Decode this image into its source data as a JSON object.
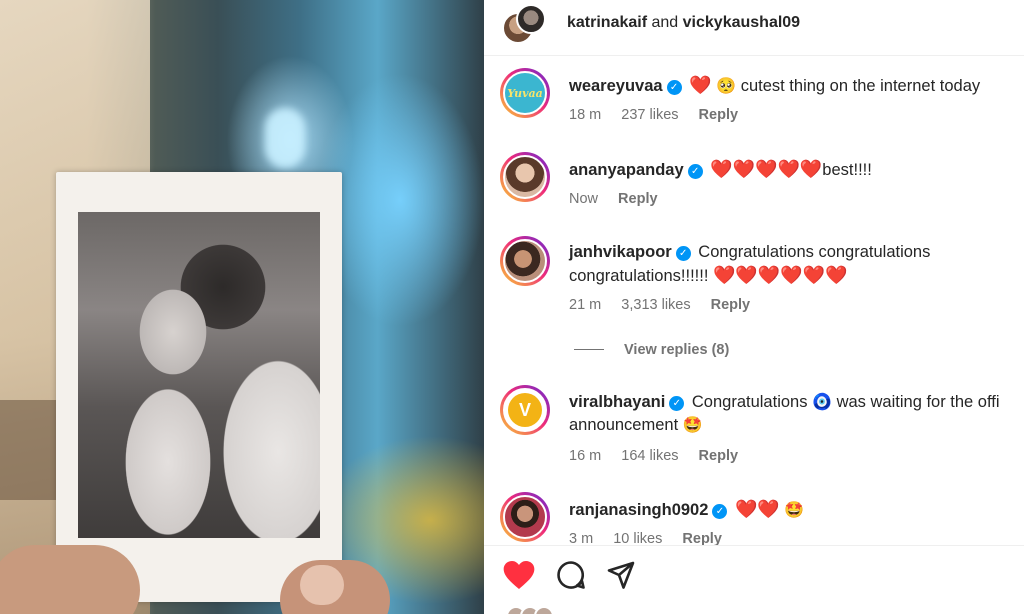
{
  "header": {
    "user1": "katrinakaif",
    "conjunction": "and",
    "user2": "vickykaushal09"
  },
  "comments": [
    {
      "username": "weareyuvaa",
      "avatar_text": "Yuvaa",
      "text": "cutest thing on the internet today",
      "time": "18 m",
      "likes": "237 likes",
      "reply": "Reply"
    },
    {
      "username": "ananyapanday",
      "text": "best!!!!",
      "time": "Now",
      "reply": "Reply"
    },
    {
      "username": "janhvikapoor",
      "text_line1": "Congratulations congratulations",
      "text_line2": "congratulations!!!!!!",
      "time": "21 m",
      "likes": "3,313 likes",
      "reply": "Reply"
    },
    {
      "username": "viralbhayani",
      "text_a": "Congratulations",
      "text_b": "was waiting for the offi",
      "text_line2": "announcement",
      "time": "16 m",
      "likes": "164 likes",
      "reply": "Reply"
    },
    {
      "username": "ranjanasingh0902",
      "time": "3 m",
      "likes": "10 likes",
      "reply": "Reply"
    }
  ],
  "view_replies": "View replies (8)",
  "icons": {
    "heart": "heart-icon",
    "comment": "comment-icon",
    "share": "share-icon",
    "verified": "verified-badge-icon"
  },
  "colors": {
    "like_red": "#ff3040",
    "verified_blue": "#0095f6"
  }
}
